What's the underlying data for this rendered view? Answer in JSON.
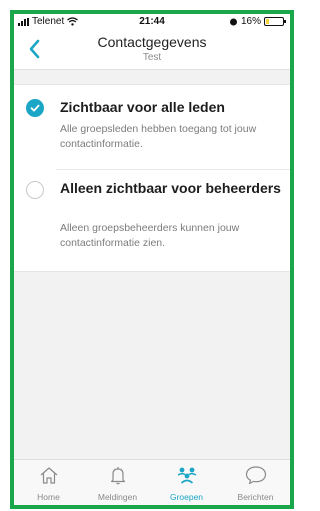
{
  "status_bar": {
    "carrier": "Telenet",
    "time": "21:44",
    "battery": "16%",
    "battery_level": 0.16
  },
  "header": {
    "title": "Contactgegevens",
    "subtitle": "Test"
  },
  "options": [
    {
      "title": "Zichtbaar voor alle leden",
      "description": "Alle groepsleden hebben toegang tot jouw contactinformatie.",
      "selected": true
    },
    {
      "title": "Alleen zichtbaar voor beheerders",
      "description": "Alleen groepsbeheerders kunnen jouw contactinformatie zien.",
      "selected": false
    }
  ],
  "tabbar": {
    "items": [
      {
        "label": "Home",
        "icon": "home-icon",
        "active": false
      },
      {
        "label": "Meldingen",
        "icon": "bell-icon",
        "active": false
      },
      {
        "label": "Groepen",
        "icon": "groups-icon",
        "active": true
      },
      {
        "label": "Berichten",
        "icon": "chat-bubble-icon",
        "active": false
      }
    ]
  },
  "colors": {
    "accent": "#1aa6c4",
    "frame": "#1aa64a"
  }
}
